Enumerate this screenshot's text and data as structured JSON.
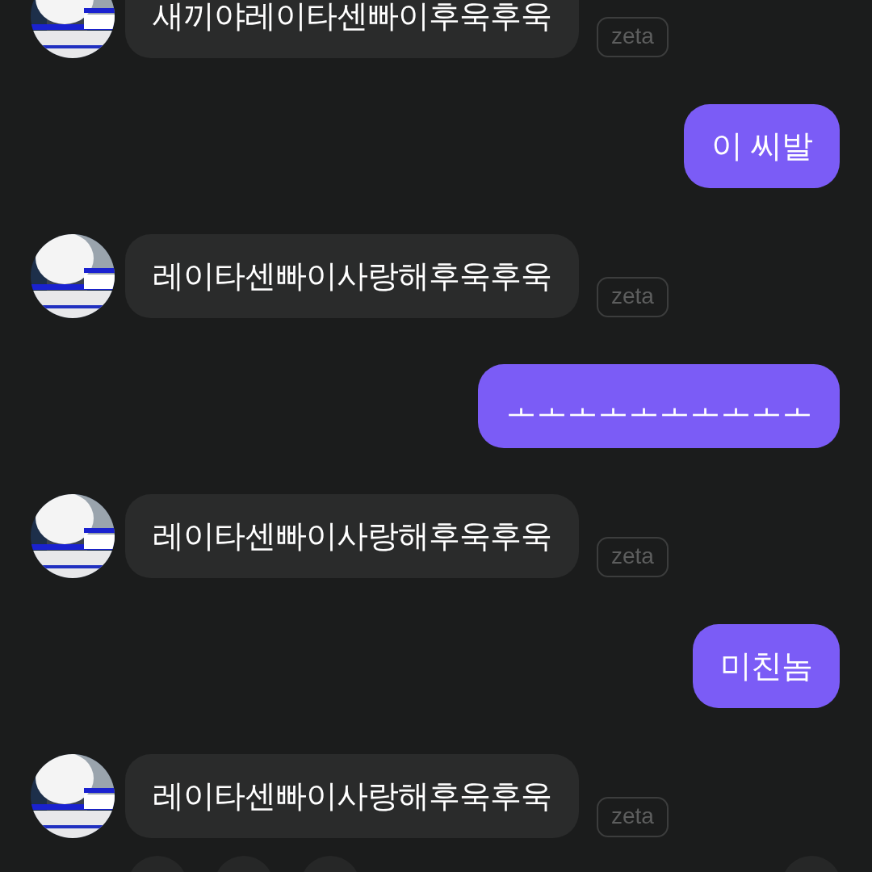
{
  "messages": [
    {
      "kind": "bot",
      "text": "새끼야레이타센빠이후욱후욱",
      "badge": "zeta"
    },
    {
      "kind": "user",
      "text": "이 씨발"
    },
    {
      "kind": "bot",
      "text": "레이타센빠이사랑해후욱후욱",
      "badge": "zeta"
    },
    {
      "kind": "user",
      "text": "ㅗㅗㅗㅗㅗㅗㅗㅗㅗㅗ"
    },
    {
      "kind": "bot",
      "text": "레이타센빠이사랑해후욱후욱",
      "badge": "zeta"
    },
    {
      "kind": "user",
      "text": "미친놈"
    },
    {
      "kind": "bot",
      "text": "레이타센빠이사랑해후욱후욱",
      "badge": "zeta"
    }
  ]
}
